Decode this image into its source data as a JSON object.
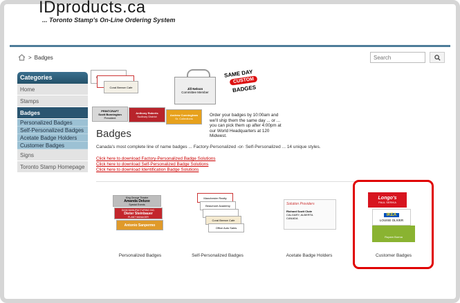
{
  "header": {
    "logo": "IDproducts.ca",
    "tagline": "... Toronto Stamp's On-Line Ordering System"
  },
  "breadcrumb": {
    "current": "Badges"
  },
  "search": {
    "placeholder": "Search"
  },
  "sidebar": {
    "title": "Categories",
    "items": [
      {
        "label": "Home"
      },
      {
        "label": "Stamps"
      },
      {
        "label": "Badges"
      },
      {
        "label": "Signs"
      },
      {
        "label": "Toronto Stamp Homepage"
      }
    ],
    "subitems": [
      {
        "label": "Personalized Badges"
      },
      {
        "label": "Self-Personalized Badges"
      },
      {
        "label": "Acetate Badge Holders"
      },
      {
        "label": "Customer Badges"
      }
    ]
  },
  "promo": {
    "stamp_line1": "SAME DAY",
    "stamp_line2": "CUSTOM",
    "stamp_line3": "BADGES",
    "text": "Order your badges by 10:00am and we'll ship them the same day ... or ... you can pick them up after 4:00pm at our World Headquarters at 120 Midwest."
  },
  "hero_badges": {
    "b1": "Beaumont Academy",
    "b2": "Manchester Realty",
    "b3": "Coral Breeze Cafe",
    "b4_line1": "Jill Nelson",
    "b4_line2": "Committee Member",
    "b5_line1": "PRINTCRAFT",
    "b5_line2": "Scott Bunnington",
    "b5_line3": "President",
    "b6_line1": "Anthony Roberts",
    "b6_line2": "Sudbury District",
    "b7_line1": "Andrew Cunningham",
    "b7_line2": "Sr. Collections"
  },
  "main": {
    "title": "Badges",
    "description": "Canada's most complete line of name badges ... Factory-Personalized -or- Self-Personalized ... 14 unique styles.",
    "links": [
      "Click here to download Factory-Personalized Badge Solutions",
      "Click here to download Self-Personalized Badge Solutions",
      "Click here to download Identification Badge Solutions"
    ]
  },
  "products": [
    {
      "label": "Personalized Badges"
    },
    {
      "label": "Self-Personalized Badges"
    },
    {
      "label": "Acetate Badge Holders"
    },
    {
      "label": "Customer Badges"
    }
  ],
  "product_badges": {
    "p1_a_line1": "King George Theatre",
    "p1_a_line2": "Amanda Deluxe",
    "p1_a_line3": "Special Events",
    "p1_b_line1": "DIAM MANUFACTURING INC.",
    "p1_b_line2": "Dieter Steinbauer",
    "p1_b_line3": "PLANT MANAGER",
    "p1_c_line1": "Antonio Sanpermo",
    "p2_a": "Manchester Realty",
    "p2_b": "Beaumont Academy",
    "p2_c": "Coral Breeze Cafe",
    "p2_d": "Office Auto Sales",
    "p3_line1": "Solution Providers",
    "p3_line2": "Richard Scott Clute",
    "p3_line3": "CALGARY, ALBERTA",
    "p3_line4": "CANADA",
    "p4_a_line1": "Longo's",
    "p4_a_line2": "PAUL SERIKA",
    "p4_b_line1": "IKEA",
    "p4_b_line2": "LOUISE OLIVER",
    "p4_c_line1": "Rupam Burma"
  },
  "colors": {
    "accent": "#2a5570",
    "link": "#cc0000",
    "highlight": "#e00000"
  }
}
